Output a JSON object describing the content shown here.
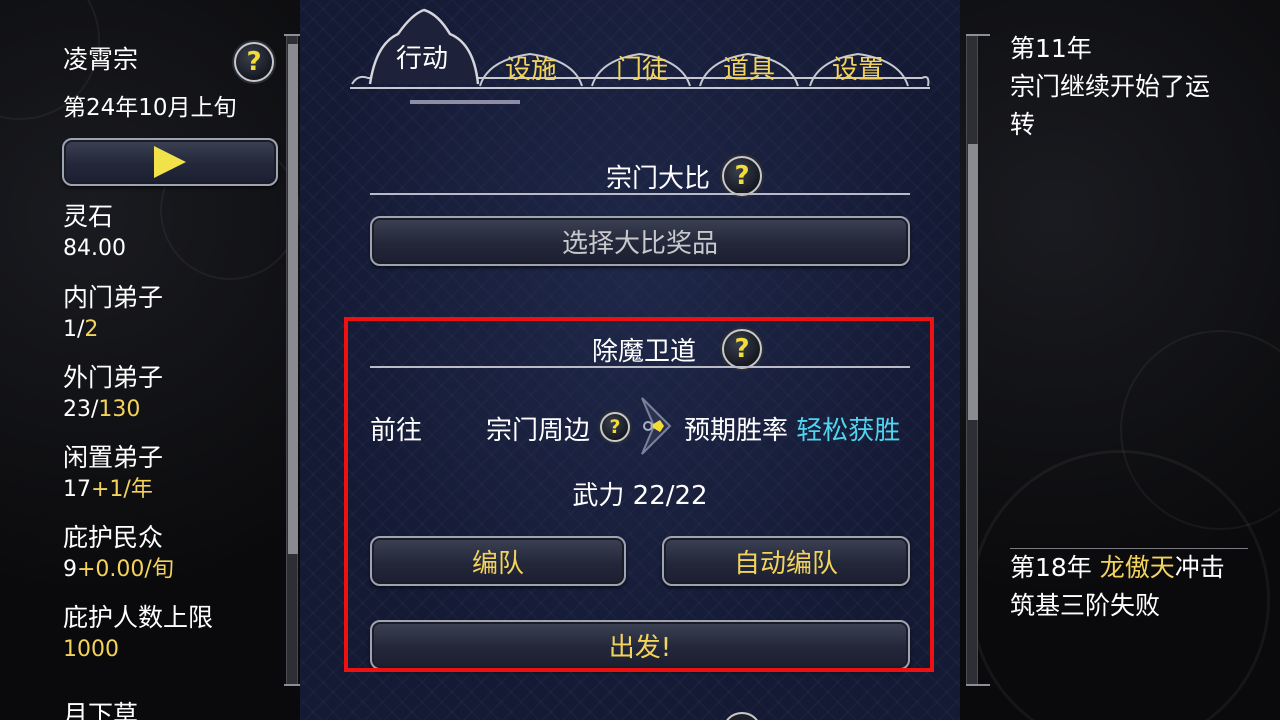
{
  "left": {
    "sect_name": "凌霄宗",
    "date": "第24年10月上旬",
    "play_icon": "play-icon",
    "stats": [
      {
        "label": "灵石",
        "value": "84.00"
      },
      {
        "label": "内门弟子",
        "value_a": "1/",
        "value_b": "2"
      },
      {
        "label": "外门弟子",
        "value_a": "23/",
        "value_b": "130"
      },
      {
        "label": "闲置弟子",
        "value_a": "17",
        "value_b": "+1/年"
      },
      {
        "label": "庇护民众",
        "value_a": "9",
        "value_b": "+0.00/旬"
      },
      {
        "label": "庇护人数上限",
        "value": "1000"
      },
      {
        "label": "月下草"
      }
    ]
  },
  "tabs": [
    "行动",
    "设施",
    "门徒",
    "道具",
    "设置"
  ],
  "contest": {
    "title": "宗门大比",
    "select_button": "选择大比奖品"
  },
  "demon": {
    "title": "除魔卫道",
    "goto_label": "前往",
    "location": "宗门周边",
    "win_rate_label": "预期胜率",
    "win_rate_value": "轻松获胜",
    "power": "武力 22/22",
    "team_button": "编队",
    "auto_team_button": "自动编队",
    "depart_button": "出发!"
  },
  "log": {
    "entry1": "第11年\n宗门继续开始了运\n转",
    "entry2_prefix": "第18年 ",
    "entry2_name": "龙傲天",
    "entry2_suffix": "冲击",
    "entry2_line2": "筑基三阶失败"
  },
  "colors": {
    "accent_yellow": "#f3d35c",
    "win_cyan": "#4fd4f0",
    "highlight_red": "#ee1111"
  }
}
